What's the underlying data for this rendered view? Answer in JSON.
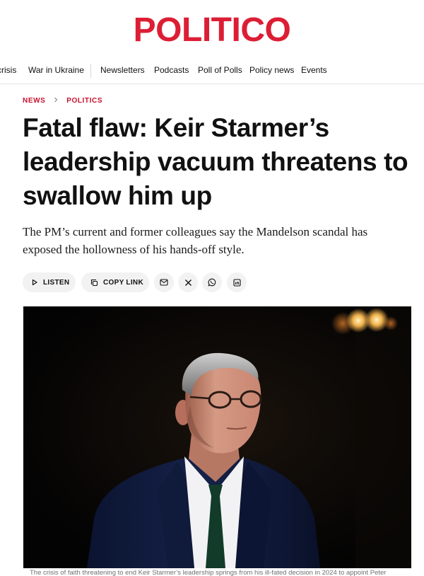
{
  "brand": {
    "logo_text": "POLITICO",
    "accent_color": "#dc1e35"
  },
  "nav": {
    "items": [
      {
        "label": "crisis"
      },
      {
        "label": "War in Ukraine"
      },
      {
        "label": "Newsletters"
      },
      {
        "label": "Podcasts"
      },
      {
        "label": "Poll of Polls"
      },
      {
        "label": "Policy news"
      },
      {
        "label": "Events"
      }
    ]
  },
  "breadcrumb": {
    "items": [
      {
        "label": "NEWS"
      },
      {
        "label": "POLITICS"
      }
    ],
    "separator_icon": "chevron-right-icon"
  },
  "article": {
    "headline": "Fatal flaw: Keir Starmer’s leadership vacuum threatens to swallow him up",
    "dek": "The PM’s current and former colleagues say the Mandelson scandal has exposed the hollowness of his hands-off style.",
    "image_caption": "The crisis of faith threatening to end Keir Starmer’s leadership springs from his ill-fated decision in 2024 to appoint Peter"
  },
  "share": {
    "listen_label": "LISTEN",
    "listen_icon": "play-icon",
    "copy_label": "COPY LINK",
    "copy_icon": "copy-icon",
    "icons": [
      "mail-icon",
      "x-icon",
      "whatsapp-icon",
      "linkedin-icon"
    ]
  }
}
